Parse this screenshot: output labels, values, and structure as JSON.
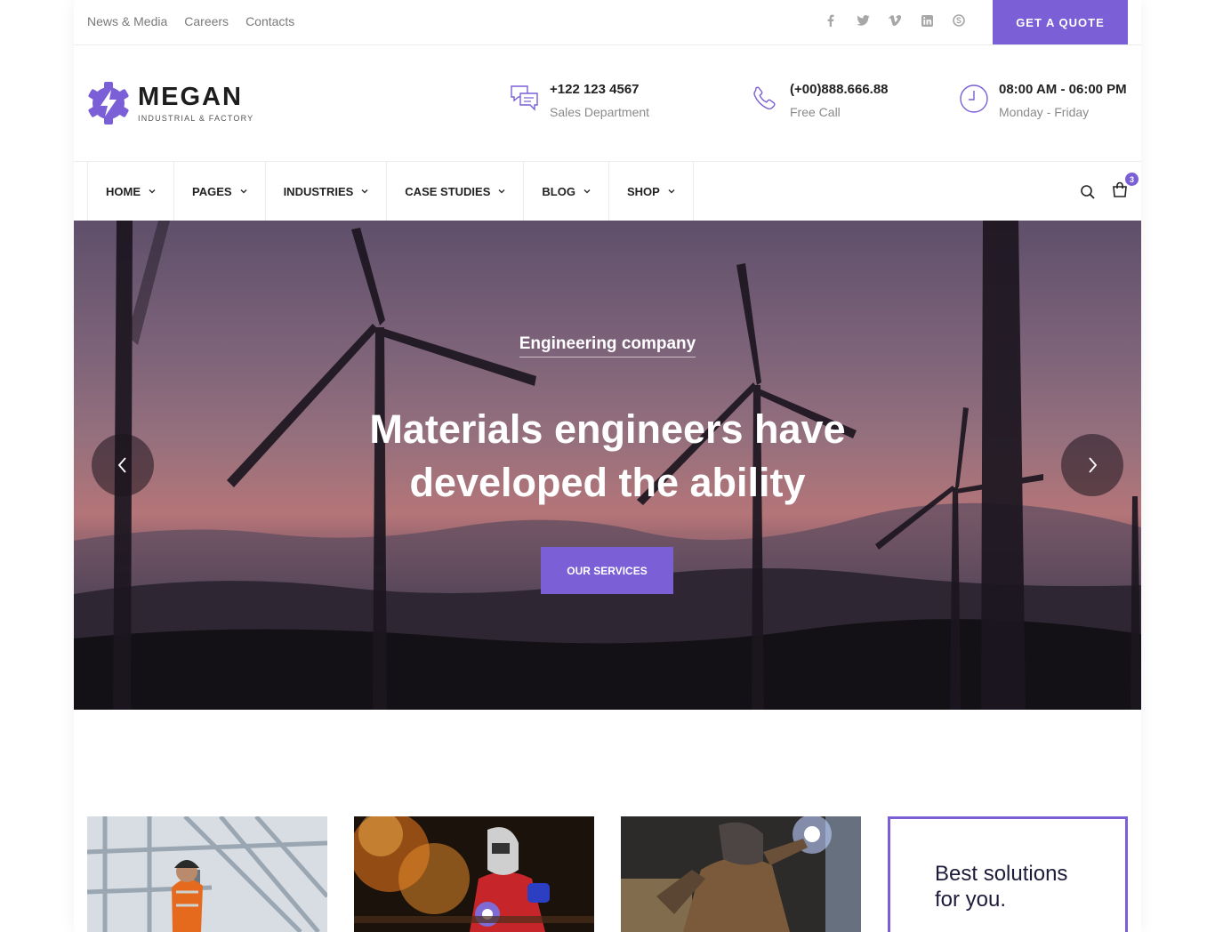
{
  "topbar": {
    "links": [
      "News & Media",
      "Careers",
      "Contacts"
    ],
    "social_icons": [
      "facebook-icon",
      "twitter-icon",
      "vimeo-icon",
      "linkedin-icon",
      "skype-icon"
    ],
    "quote_label": "GET A QUOTE"
  },
  "brand": {
    "name": "MEGAN",
    "tagline": "INDUSTRIAL & FACTORY",
    "accent": "#7a5fd6"
  },
  "contact": {
    "phone": {
      "value": "+122 123 4567",
      "label": "Sales Department"
    },
    "call": {
      "value": "(+00)888.666.88",
      "label": "Free Call"
    },
    "hours": {
      "value": "08:00 AM - 06:00 PM",
      "label": "Monday - Friday"
    }
  },
  "nav": {
    "items": [
      "HOME",
      "PAGES",
      "INDUSTRIES",
      "CASE STUDIES",
      "BLOG",
      "SHOP"
    ],
    "cart_count": "3"
  },
  "hero": {
    "subtitle": "Engineering company",
    "title": "Materials engineers have developed the ability",
    "button": "OUR SERVICES"
  },
  "promo": {
    "best_text": "Best solutions for you."
  }
}
